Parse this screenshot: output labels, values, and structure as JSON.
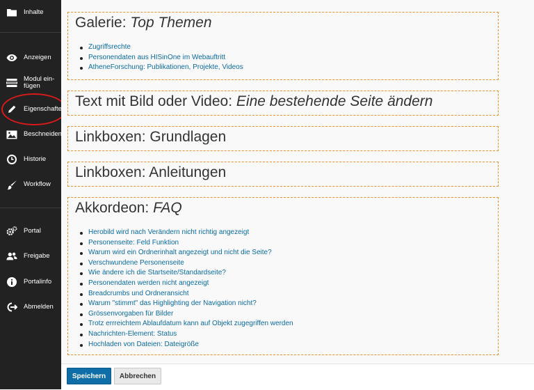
{
  "sidebar": {
    "items": [
      {
        "label": "Inhalte",
        "icon": "folder-icon"
      },
      {
        "label": "Anzeigen",
        "icon": "eye-icon"
      },
      {
        "label": "Modul ein-\nfügen",
        "icon": "insert-module-icon"
      },
      {
        "label": "Eigenschaften",
        "icon": "pencil-icon"
      },
      {
        "label": "Beschneiden",
        "icon": "image-icon"
      },
      {
        "label": "Historie",
        "icon": "clock-icon"
      },
      {
        "label": "Workflow",
        "icon": "brush-icon"
      },
      {
        "label": "Portal",
        "icon": "gears-icon"
      },
      {
        "label": "Freigabe",
        "icon": "users-icon"
      },
      {
        "label": "Portalinfo",
        "icon": "info-icon"
      },
      {
        "label": "Abmelden",
        "icon": "logout-icon"
      }
    ],
    "highlighted": "Eigenschaften",
    "highlight_color": "#d71a1a"
  },
  "main": {
    "boxes": [
      {
        "title_prefix": "Galerie: ",
        "title_emph": "Top Themen",
        "links": [
          "Zugriffsrechte",
          "Personendaten aus HISinOne im Webauftritt",
          "AtheneForschung: Publikationen, Projekte, Videos"
        ]
      },
      {
        "title_prefix": "Text mit Bild oder Video: ",
        "title_emph": "Eine bestehende Seite ändern",
        "links": []
      },
      {
        "title_prefix": "Linkboxen: Grundlagen",
        "title_emph": "",
        "links": []
      },
      {
        "title_prefix": "Linkboxen: Anleitungen",
        "title_emph": "",
        "links": []
      },
      {
        "title_prefix": "Akkordeon: ",
        "title_emph": "FAQ",
        "links": [
          "Herobild wird nach Verändern nicht richtig angezeigt",
          "Personenseite: Feld Funktion",
          "Warum wird ein Ordnerinhalt angezeigt und nicht die Seite?",
          "Verschwundene Personenseite",
          "Wie ändere ich die Startseite/Standardseite?",
          "Personendaten werden nicht angezeigt",
          "Breadcrumbs und Ordneransicht",
          "Warum \"stimmt\" das Highlighting der Navigation nicht?",
          "Grössenvorgaben für Bilder",
          "Trotz errreichtem Ablaufdatum kann auf Objekt zugegriffen werden",
          "Nachrichten-Element: Status",
          "Hochladen von Dateien: Dateigröße"
        ]
      }
    ],
    "border_color": "#e8902a",
    "link_color": "#0a6aa0"
  },
  "footer": {
    "save_label": "Speichern",
    "cancel_label": "Abbrechen",
    "save_color": "#0f6ea8"
  }
}
